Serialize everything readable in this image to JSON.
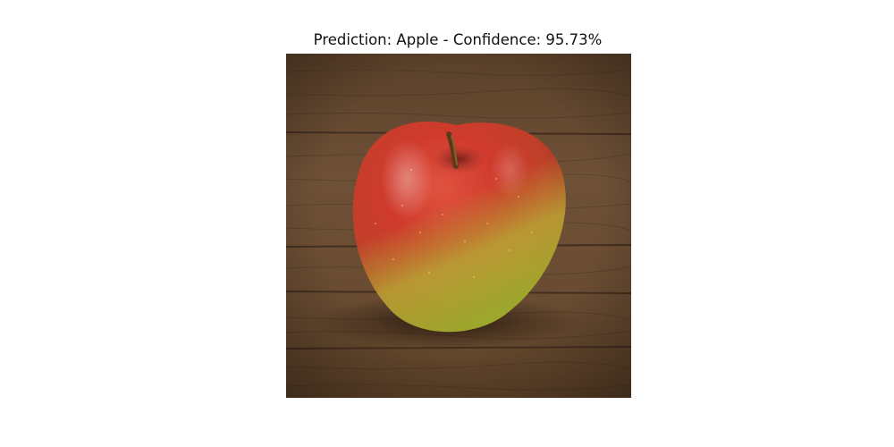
{
  "figure": {
    "title": "Prediction: Apple - Confidence: 95.73%"
  },
  "prediction": {
    "label": "Apple",
    "confidence": "95.73%"
  },
  "image": {
    "subject": "red-green apple on wooden table",
    "colors": {
      "wood_light": "#7a5a3e",
      "wood_dark": "#4a3322",
      "apple_red": "#c8322a",
      "apple_green": "#a8b532",
      "stem": "#6b4a1e"
    }
  }
}
